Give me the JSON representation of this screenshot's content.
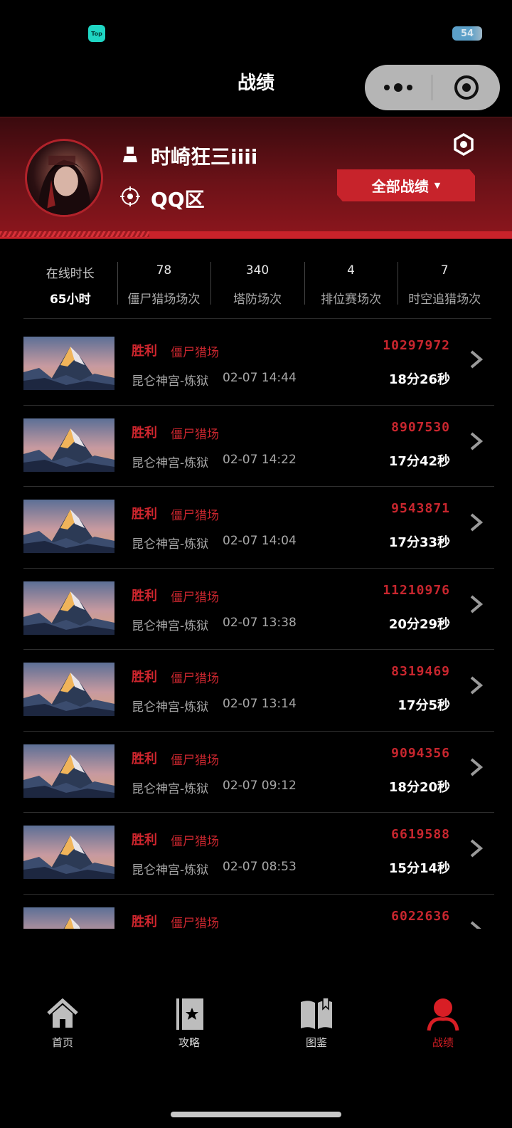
{
  "status_bar": {
    "app_badge": "Top",
    "battery": "54"
  },
  "nav": {
    "title": "战绩"
  },
  "profile": {
    "username": "时崎狂三iiii",
    "region": "QQ区",
    "filter_label": "全部战绩",
    "filter_caret": "▼"
  },
  "stats": [
    {
      "top": "在线时长",
      "bottom": "65小时"
    },
    {
      "top": "78",
      "bottom": "僵尸猎场场次"
    },
    {
      "top": "340",
      "bottom": "塔防场次"
    },
    {
      "top": "4",
      "bottom": "排位赛场次"
    },
    {
      "top": "7",
      "bottom": "时空追猎场次"
    }
  ],
  "records": [
    {
      "result": "胜利",
      "mode": "僵尸猎场",
      "map": "昆仑神宫-炼狱",
      "time": "02-07 14:44",
      "score": "10297972",
      "duration": "18分26秒"
    },
    {
      "result": "胜利",
      "mode": "僵尸猎场",
      "map": "昆仑神宫-炼狱",
      "time": "02-07 14:22",
      "score": "8907530",
      "duration": "17分42秒"
    },
    {
      "result": "胜利",
      "mode": "僵尸猎场",
      "map": "昆仑神宫-炼狱",
      "time": "02-07 14:04",
      "score": "9543871",
      "duration": "17分33秒"
    },
    {
      "result": "胜利",
      "mode": "僵尸猎场",
      "map": "昆仑神宫-炼狱",
      "time": "02-07 13:38",
      "score": "11210976",
      "duration": "20分29秒"
    },
    {
      "result": "胜利",
      "mode": "僵尸猎场",
      "map": "昆仑神宫-炼狱",
      "time": "02-07 13:14",
      "score": "8319469",
      "duration": "17分5秒"
    },
    {
      "result": "胜利",
      "mode": "僵尸猎场",
      "map": "昆仑神宫-炼狱",
      "time": "02-07 09:12",
      "score": "9094356",
      "duration": "18分20秒"
    },
    {
      "result": "胜利",
      "mode": "僵尸猎场",
      "map": "昆仑神宫-炼狱",
      "time": "02-07 08:53",
      "score": "6619588",
      "duration": "15分14秒"
    },
    {
      "result": "胜利",
      "mode": "僵尸猎场",
      "map": "",
      "time": "",
      "score": "6022636",
      "duration": ""
    }
  ],
  "tabbar": {
    "items": [
      {
        "label": "首页",
        "icon": "home-icon"
      },
      {
        "label": "攻略",
        "icon": "guide-icon"
      },
      {
        "label": "图鉴",
        "icon": "book-icon"
      },
      {
        "label": "战绩",
        "icon": "profile-icon",
        "active": true
      }
    ]
  },
  "colors": {
    "accent": "#c7232b",
    "active_tab": "#d81e25",
    "background": "#000000"
  }
}
